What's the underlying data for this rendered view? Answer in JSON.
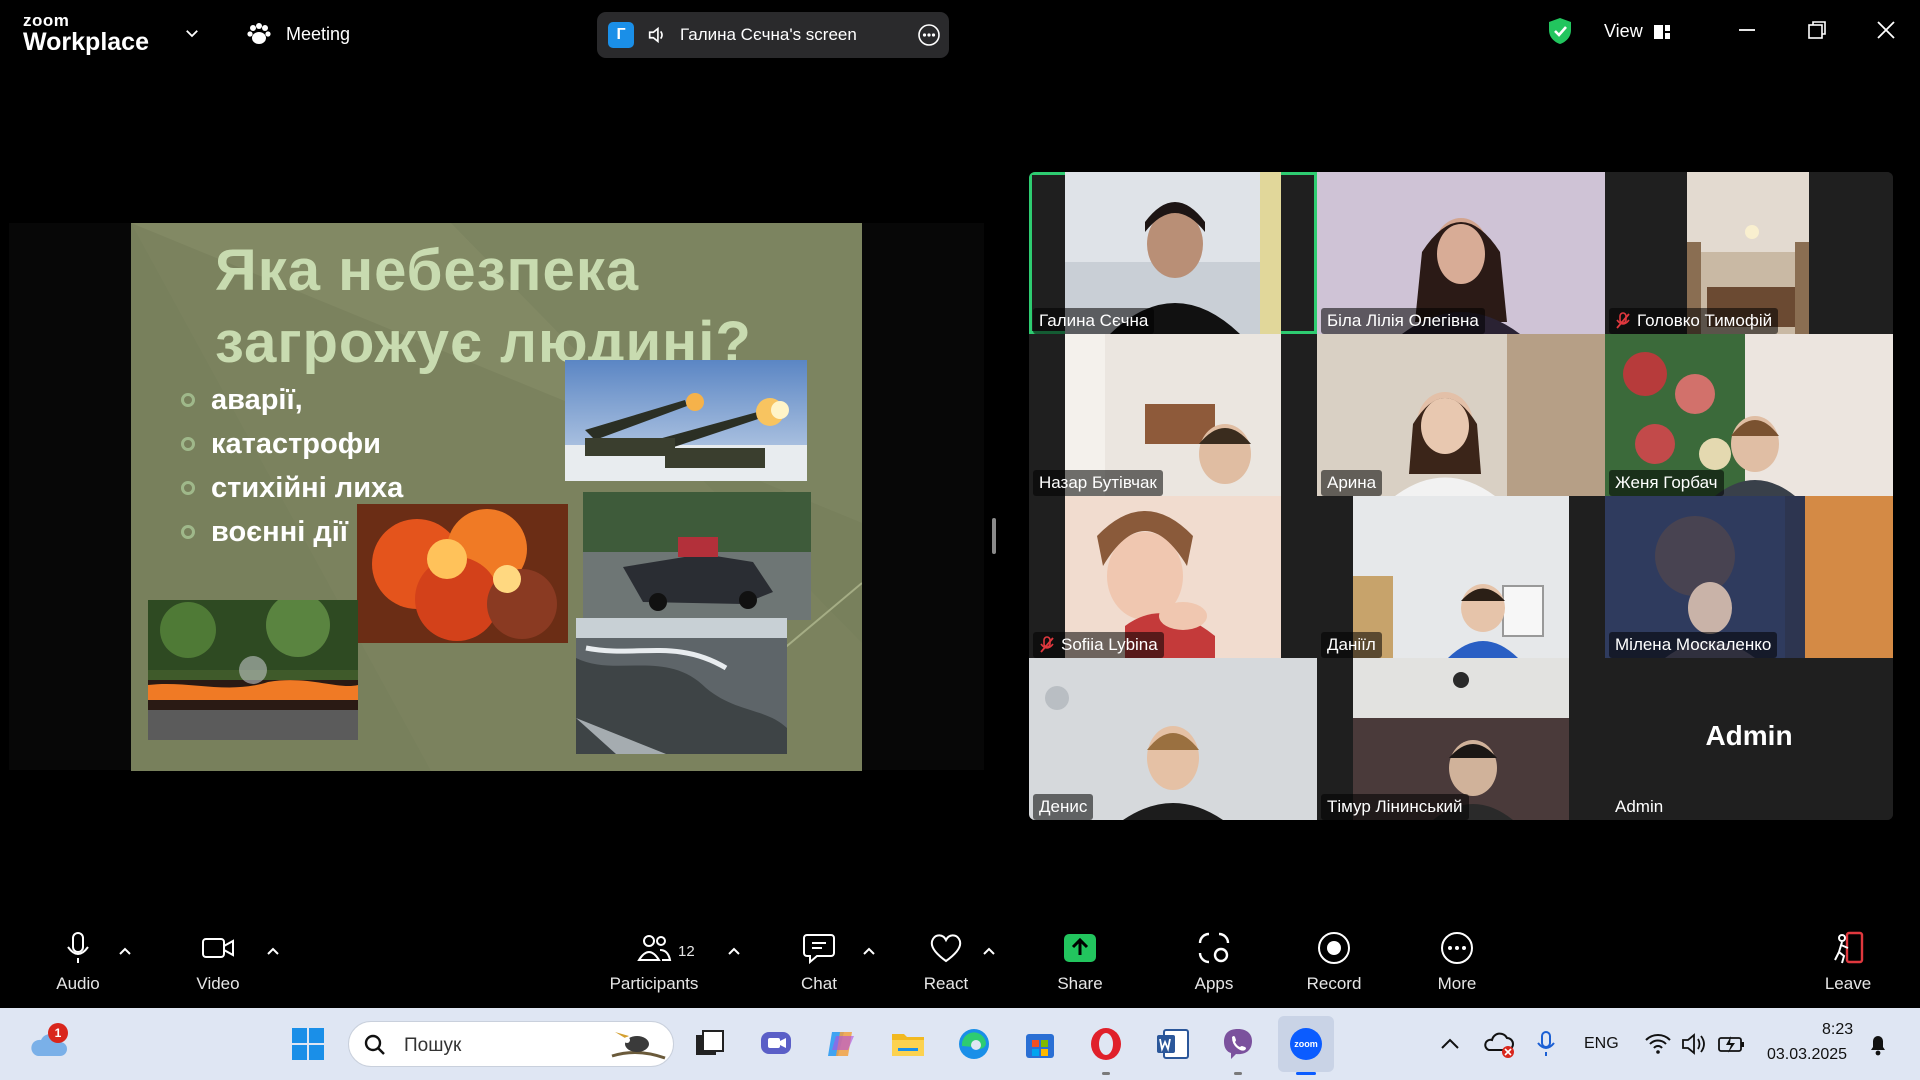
{
  "titlebar": {
    "logo_top": "zoom",
    "logo_bottom": "Workplace",
    "meeting_label": "Meeting",
    "screen_badge": "Г",
    "screen_name": "Галина Сєчна's screen",
    "view_label": "View",
    "accent_shield": "#22c55e"
  },
  "slide": {
    "title_line1": "Яка небезпека",
    "title_line2": "загрожує людині?",
    "bullets": [
      "аварії,",
      " катастрофи",
      " стихійні лиха",
      "воєнні дії"
    ]
  },
  "participants": [
    {
      "name": "Галина Сєчна",
      "muted": false,
      "active": true
    },
    {
      "name": "Біла Лілія Олегівна",
      "muted": false
    },
    {
      "name": "Головко Тимофій",
      "muted": true
    },
    {
      "name": "Назар Бутівчак",
      "muted": false
    },
    {
      "name": "Арина",
      "muted": false
    },
    {
      "name": "Женя Горбач",
      "muted": false
    },
    {
      "name": "Sofiia Lybina",
      "muted": true
    },
    {
      "name": "Даніїл",
      "muted": false
    },
    {
      "name": "Мілена Москаленко",
      "muted": false
    },
    {
      "name": "Денис",
      "muted": false
    },
    {
      "name": "Тімур Лінинський",
      "muted": false
    },
    {
      "name": "Admin",
      "muted": false,
      "avatar_text": "Admin"
    }
  ],
  "toolbar": {
    "audio": "Audio",
    "video": "Video",
    "participants": "Participants",
    "participants_count": "12",
    "chat": "Chat",
    "react": "React",
    "share": "Share",
    "apps": "Apps",
    "record": "Record",
    "more": "More",
    "leave": "Leave",
    "share_color": "#22c55e",
    "leave_color": "#e0383e"
  },
  "taskbar": {
    "notification_count": "1",
    "search_placeholder": "Пошук",
    "language": "ENG",
    "time": "8:23",
    "date": "03.03.2025"
  }
}
